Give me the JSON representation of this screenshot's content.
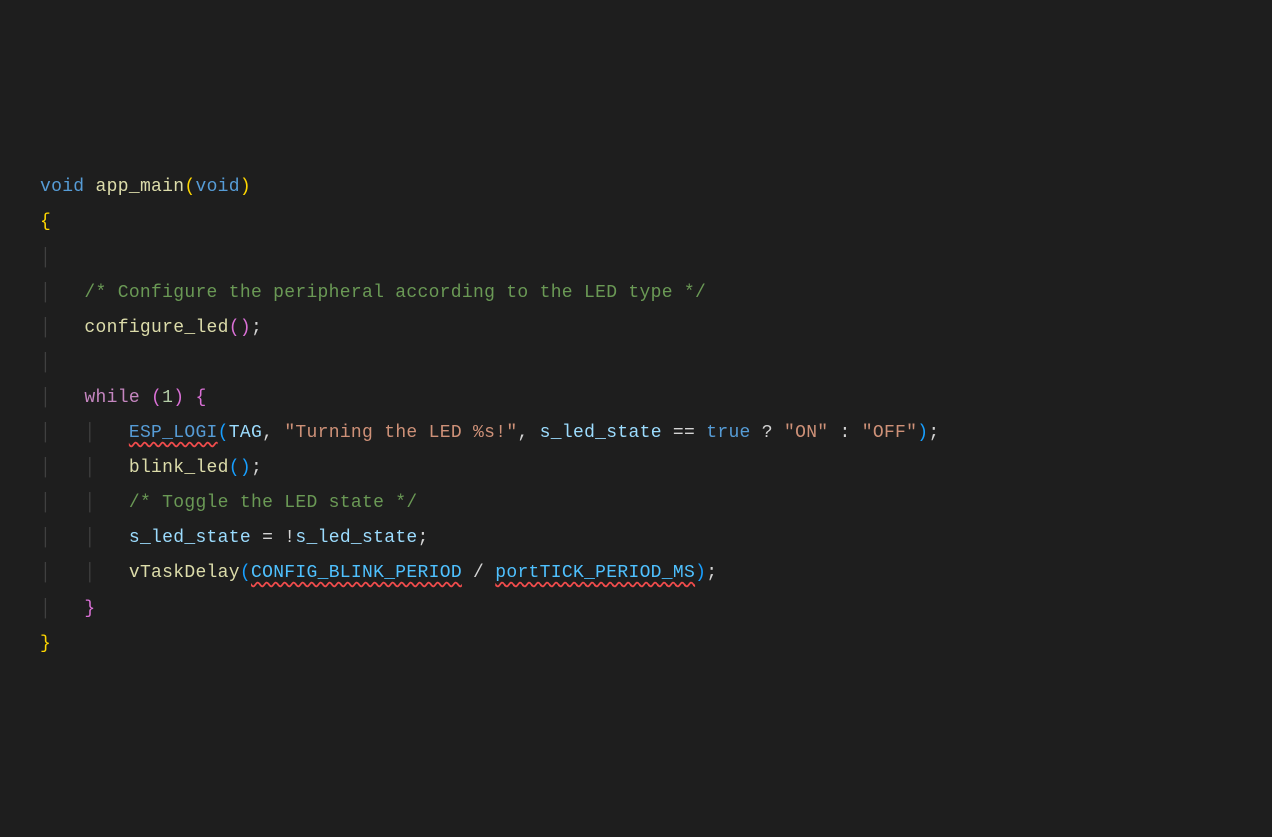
{
  "code": {
    "kw_void1": "void",
    "fn_app_main": "app_main",
    "kw_void2": "void",
    "brace_open1": "{",
    "comment1": "/* Configure the peripheral according to the LED type */",
    "fn_configure_led": "configure_led",
    "semi": ";",
    "kw_while": "while",
    "num_1": "1",
    "brace_open2": "{",
    "macro_esp_logi": "ESP_LOGI",
    "var_tag": "TAG",
    "str_turning": "\"Turning the LED %s!\"",
    "var_s_led_state": "s_led_state",
    "op_eqeq": "==",
    "kw_true": "true",
    "op_q": "?",
    "str_on": "\"ON\"",
    "op_colon": ":",
    "str_off": "\"OFF\"",
    "fn_blink_led": "blink_led",
    "comment2": "/* Toggle the LED state */",
    "op_assign": "=",
    "op_not": "!",
    "fn_vtaskdelay": "vTaskDelay",
    "const_blink_period": "CONFIG_BLINK_PERIOD",
    "op_div": "/",
    "const_tick_ms": "portTICK_PERIOD_MS",
    "brace_close2": "}",
    "brace_close1": "}",
    "guide": "│"
  }
}
